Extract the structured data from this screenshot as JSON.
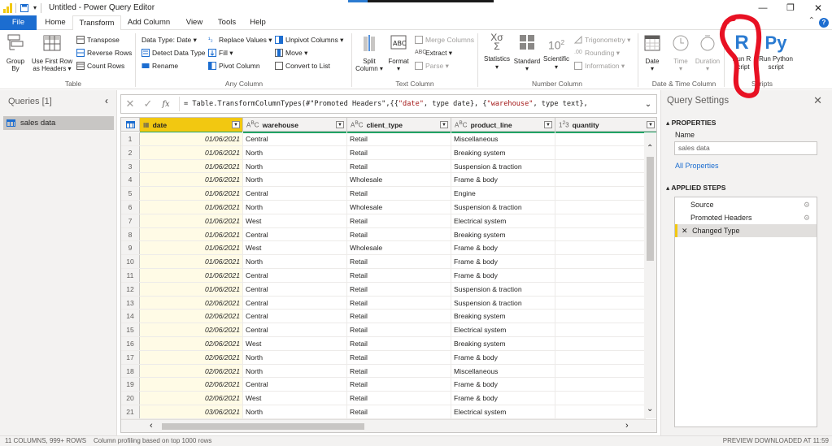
{
  "window": {
    "title": "Untitled - Power Query Editor",
    "minimize": "—",
    "restore": "❐",
    "close": "✕"
  },
  "menu": {
    "tabs": [
      "File",
      "Home",
      "Transform",
      "Add Column",
      "View",
      "Tools",
      "Help"
    ],
    "active": "Transform",
    "help_icon": "?"
  },
  "ribbon": {
    "table": {
      "group_label": "Table",
      "group_by": "Group\nBy",
      "use_first_row": "Use First Row\nas Headers ▾",
      "transpose": "Transpose",
      "reverse_rows": "Reverse Rows",
      "count_rows": "Count Rows"
    },
    "any_column": {
      "group_label": "Any Column",
      "data_type": "Data Type: Date ▾",
      "detect_data_type": "Detect Data Type",
      "rename": "Rename",
      "replace_values": "Replace Values ▾",
      "fill": "Fill ▾",
      "pivot_column": "Pivot Column",
      "unpivot_columns": "Unpivot Columns ▾",
      "move": "Move ▾",
      "convert_to_list": "Convert to List"
    },
    "text_column": {
      "group_label": "Text Column",
      "split_column": "Split\nColumn ▾",
      "format": "Format\n▾",
      "merge_columns": "Merge Columns",
      "extract": "Extract ▾",
      "parse": "Parse ▾"
    },
    "number_column": {
      "group_label": "Number Column",
      "statistics": "Statistics\n▾",
      "standard": "Standard\n▾",
      "scientific": "Scientific\n▾",
      "trigonometry": "Trigonometry ▾",
      "rounding": "Rounding ▾",
      "information": "Information ▾"
    },
    "datetime_column": {
      "group_label": "Date & Time Column",
      "date": "Date\n▾",
      "time": "Time\n▾",
      "duration": "Duration\n▾"
    },
    "scripts": {
      "group_label": "Scripts",
      "run_r": "Run R\nscript",
      "run_python": "Run Python\nscript"
    }
  },
  "queries": {
    "header": "Queries [1]",
    "collapse": "‹",
    "items": [
      "sales data"
    ]
  },
  "formula": {
    "cancel": "✕",
    "commit": "✓",
    "fx": "fx",
    "prefix": "= Table.TransformColumnTypes(#\"Promoted Headers\",{{",
    "s1": "\"date\"",
    "mid1": ", type date}, {",
    "s2": "\"warehouse\"",
    "mid2": ", type text},",
    "expand": "⌄"
  },
  "grid": {
    "columns": [
      {
        "name": "date",
        "type": "▦"
      },
      {
        "name": "warehouse",
        "type": "A B C"
      },
      {
        "name": "client_type",
        "type": "A B C"
      },
      {
        "name": "product_line",
        "type": "A B C"
      },
      {
        "name": "quantity",
        "type": "1 2 3"
      }
    ],
    "rows": [
      [
        "1",
        "01/06/2021",
        "Central",
        "Retail",
        "Miscellaneous",
        ""
      ],
      [
        "2",
        "01/06/2021",
        "North",
        "Retail",
        "Breaking system",
        ""
      ],
      [
        "3",
        "01/06/2021",
        "North",
        "Retail",
        "Suspension & traction",
        ""
      ],
      [
        "4",
        "01/06/2021",
        "North",
        "Wholesale",
        "Frame & body",
        ""
      ],
      [
        "5",
        "01/06/2021",
        "Central",
        "Retail",
        "Engine",
        ""
      ],
      [
        "6",
        "01/06/2021",
        "North",
        "Wholesale",
        "Suspension & traction",
        ""
      ],
      [
        "7",
        "01/06/2021",
        "West",
        "Retail",
        "Electrical system",
        ""
      ],
      [
        "8",
        "01/06/2021",
        "Central",
        "Retail",
        "Breaking system",
        ""
      ],
      [
        "9",
        "01/06/2021",
        "West",
        "Wholesale",
        "Frame & body",
        ""
      ],
      [
        "10",
        "01/06/2021",
        "North",
        "Retail",
        "Frame & body",
        ""
      ],
      [
        "11",
        "01/06/2021",
        "Central",
        "Retail",
        "Frame & body",
        ""
      ],
      [
        "12",
        "01/06/2021",
        "Central",
        "Retail",
        "Suspension & traction",
        ""
      ],
      [
        "13",
        "02/06/2021",
        "Central",
        "Retail",
        "Suspension & traction",
        ""
      ],
      [
        "14",
        "02/06/2021",
        "Central",
        "Retail",
        "Breaking system",
        ""
      ],
      [
        "15",
        "02/06/2021",
        "Central",
        "Retail",
        "Electrical system",
        ""
      ],
      [
        "16",
        "02/06/2021",
        "West",
        "Retail",
        "Breaking system",
        ""
      ],
      [
        "17",
        "02/06/2021",
        "North",
        "Retail",
        "Frame & body",
        ""
      ],
      [
        "18",
        "02/06/2021",
        "North",
        "Retail",
        "Miscellaneous",
        ""
      ],
      [
        "19",
        "02/06/2021",
        "Central",
        "Retail",
        "Frame & body",
        ""
      ],
      [
        "20",
        "02/06/2021",
        "West",
        "Retail",
        "Frame & body",
        ""
      ],
      [
        "21",
        "03/06/2021",
        "North",
        "Retail",
        "Electrical system",
        ""
      ],
      [
        "22",
        "",
        "",
        "",
        "",
        ""
      ]
    ]
  },
  "settings": {
    "title": "Query Settings",
    "close": "✕",
    "properties": "PROPERTIES",
    "name_label": "Name",
    "name_value": "sales data",
    "all_properties": "All Properties",
    "applied_steps": "APPLIED STEPS",
    "steps": [
      "Source",
      "Promoted Headers",
      "Changed Type"
    ],
    "step_gear": "⚙",
    "step_delete": "✕"
  },
  "status": {
    "left": "11 COLUMNS, 999+ ROWS    Column profiling based on top 1000 rows",
    "right": "PREVIEW DOWNLOADED AT 11:59"
  },
  "colors": {
    "accent": "#1c6dd0",
    "selected_column": "#f2c811",
    "annotation": "#e81123"
  }
}
